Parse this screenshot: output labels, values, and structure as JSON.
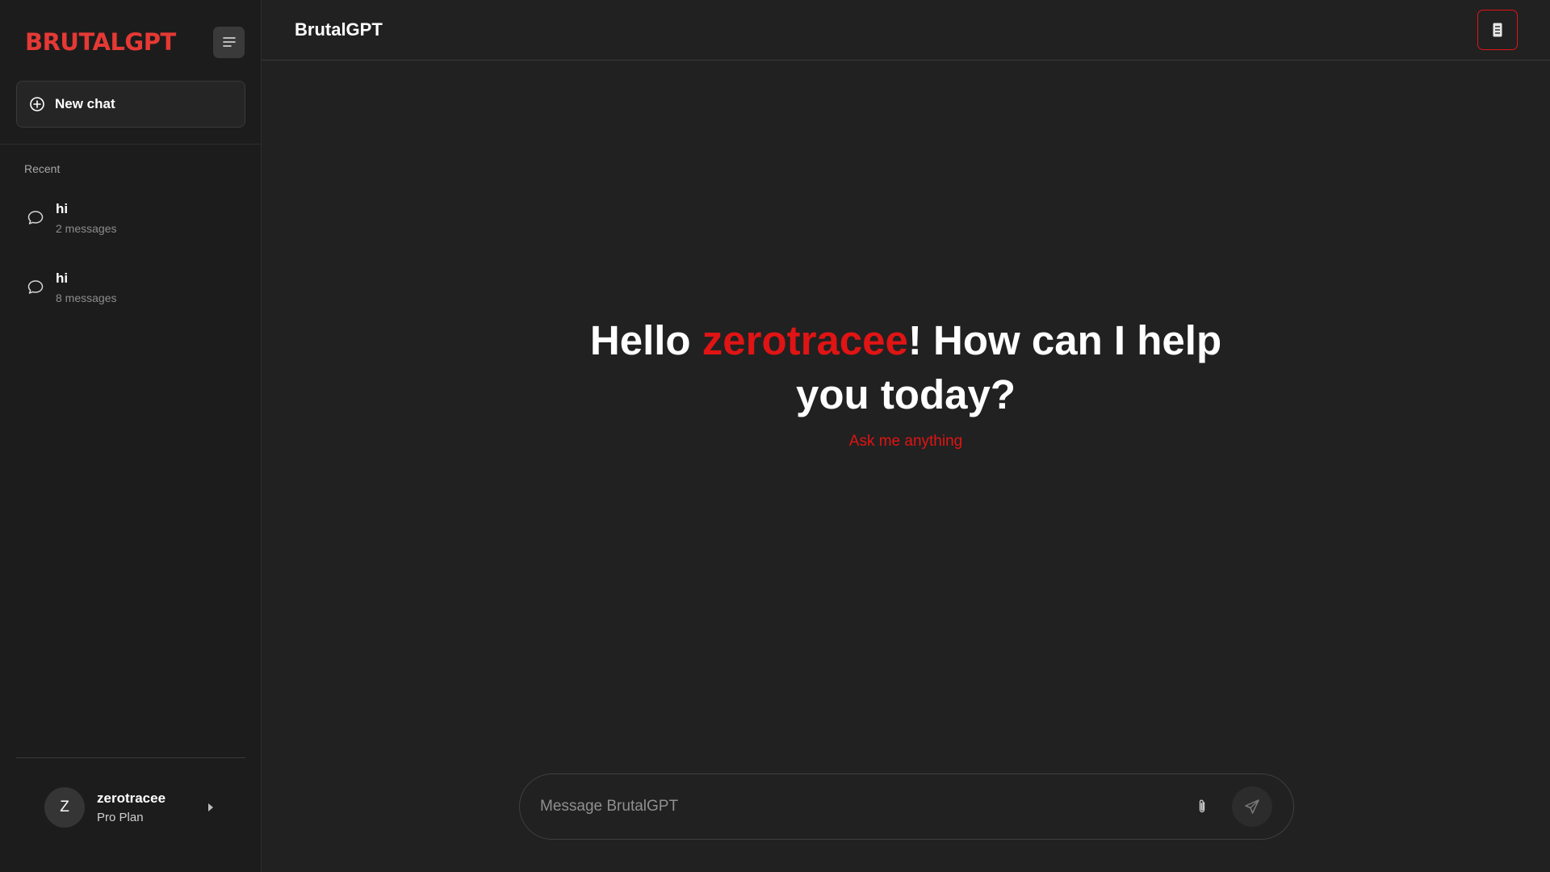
{
  "sidebar": {
    "brand": "BRUTALGPT",
    "new_chat_label": "New chat",
    "recent_label": "Recent",
    "chats": [
      {
        "title": "hi",
        "count": "2 messages"
      },
      {
        "title": "hi",
        "count": "8 messages"
      }
    ],
    "user": {
      "initial": "Z",
      "name": "zerotracee",
      "plan": "Pro Plan"
    }
  },
  "header": {
    "title": "BrutalGPT"
  },
  "hero": {
    "greeting_prefix": "Hello ",
    "username": "zerotracee",
    "greeting_suffix": "! How can I help you today?",
    "subtitle": "Ask me anything"
  },
  "composer": {
    "placeholder": "Message BrutalGPT"
  },
  "colors": {
    "accent": "#e01414",
    "background": "#212121",
    "sidebar": "#1c1c1c"
  },
  "icons": {
    "menu": "menu-lines-icon",
    "new_chat": "plus-circle-icon",
    "chat": "speech-bubble-icon",
    "top_action": "server-icon",
    "attach": "paperclip-icon",
    "send": "paper-plane-icon",
    "user_expand": "caret-right-icon"
  }
}
